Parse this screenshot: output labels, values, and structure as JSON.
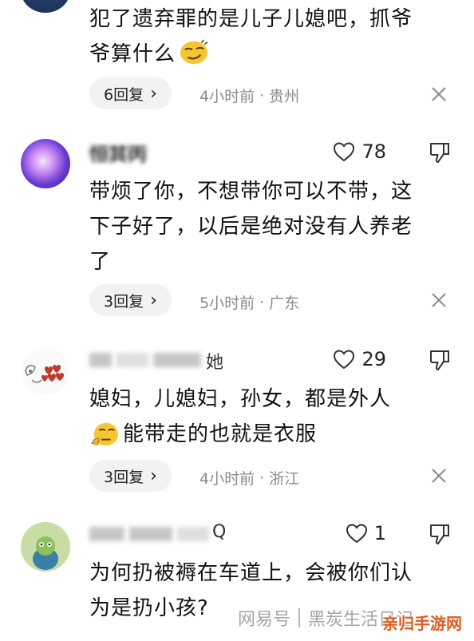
{
  "comments": [
    {
      "username": "",
      "likes": "",
      "text_lines": [
        "犯了遗弃罪的是儿子儿媳吧，抓爷",
        "爷算什么"
      ],
      "has_emoji": true,
      "replies_label": "6回复",
      "time": "4小时前",
      "location": "贵州"
    },
    {
      "username": "恒其丙",
      "likes": "78",
      "text_lines": [
        "带烦了你，不想带你可以不带，这",
        "下子好了，以后是绝对没有人养老",
        "了"
      ],
      "replies_label": "3回复",
      "time": "5小时前",
      "location": "广东"
    },
    {
      "username": "她",
      "likes": "29",
      "text_lines": [
        "媳妇，儿媳妇，孙女，都是外人",
        "能带走的也就是衣服"
      ],
      "replies_label": "3回复",
      "time": "4小时前",
      "location": "浙江"
    },
    {
      "username": "Q",
      "likes": "1",
      "text_lines": [
        "为何扔被褥在车道上，会被你们认",
        "为是扔小孩?"
      ]
    }
  ],
  "meta_separator": "·",
  "reply_chevron": "›",
  "watermark": {
    "source": "网易号",
    "author": "黑炭生活日记"
  },
  "corner_logo": "亲归手游网",
  "colors": {
    "meta_gray": "#8a8a8a",
    "pill_bg": "#f2f2f2",
    "logo_orange": "#e25a1c"
  }
}
